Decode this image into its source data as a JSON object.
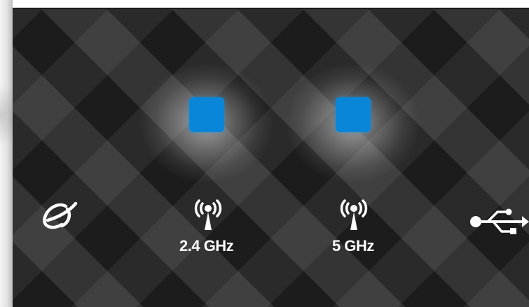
{
  "indicators": {
    "led_color": "#0a86d8",
    "text_color": "#ffffff",
    "icons": {
      "internet": "globe-icon",
      "wifi_24": "wireless-antenna-icon",
      "wifi_5": "wireless-antenna-icon",
      "usb": "usb-icon"
    },
    "labels": {
      "band_24": "2.4 GHz",
      "band_5": "5 GHz"
    }
  }
}
